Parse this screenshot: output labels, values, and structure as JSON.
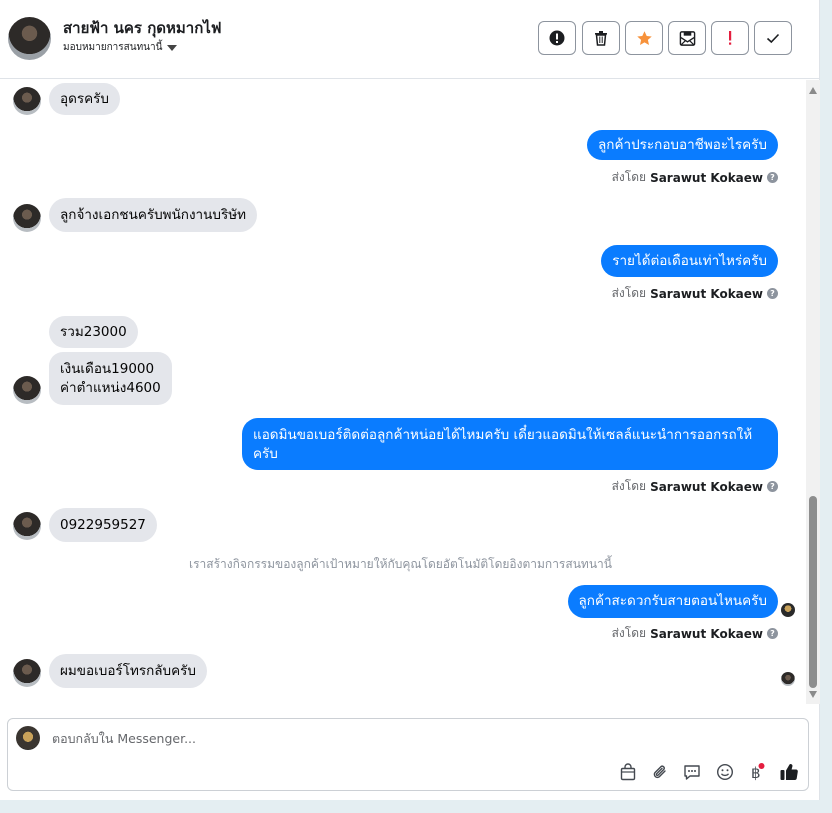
{
  "header": {
    "contact_name": "สายฟ้า นคร กุดหมากไฟ",
    "assign_label": "มอบหมายการสนทนานี้",
    "actions": [
      {
        "name": "mark-spam",
        "icon": "exclamation-circle-icon"
      },
      {
        "name": "delete",
        "icon": "trash-icon"
      },
      {
        "name": "star",
        "icon": "star-icon",
        "color": "#f7923b"
      },
      {
        "name": "archive-email",
        "icon": "mail-icon"
      },
      {
        "name": "mark-important",
        "icon": "exclamation-icon",
        "color": "#e41e3f"
      },
      {
        "name": "mark-done",
        "icon": "check-icon"
      }
    ]
  },
  "messages": {
    "m1": "อุดรครับ",
    "m2": "ลูกค้าประกอบอาชีพอะไรครับ",
    "m3": "ลูกจ้างเอกชนครับพนักงานบริษัท",
    "m4": "รายได้ต่อเดือนเท่าไหร่ครับ",
    "m5": "รวม23000",
    "m6": "เงินเดือน19000\nค่าตำแหน่ง4600",
    "m7": "แอดมินขอเบอร์ติดต่อลูกค้าหน่อยได้ไหมครับ เดี๋ยวแอดมินให้เซลล์แนะนำการออกรถให้ครับ",
    "m8": "0922959527",
    "system_note": "เราสร้างกิจกรรมของลูกค้าเป้าหมายให้กับคุณโดยอัตโนมัติโดยอิงตามการสนทนานี้",
    "m9": "ลูกค้าสะดวกรับสายตอนไหนครับ",
    "m10": "ผมขอเบอร์โทรกลับครับ"
  },
  "sent_by": {
    "prefix": "ส่งโดย",
    "agent": "Sarawut Kokaew",
    "help_glyph": "?"
  },
  "composer": {
    "placeholder": "ตอบกลับใน Messenger...",
    "tools": [
      "shopping-bag-icon",
      "paperclip-icon",
      "saved-replies-icon",
      "emoji-icon",
      "baht-payment-icon",
      "like-icon"
    ]
  },
  "colors": {
    "outgoing_bubble": "#0a7cff",
    "incoming_bubble": "#e4e6eb",
    "notification_dot": "#e41e3f"
  }
}
